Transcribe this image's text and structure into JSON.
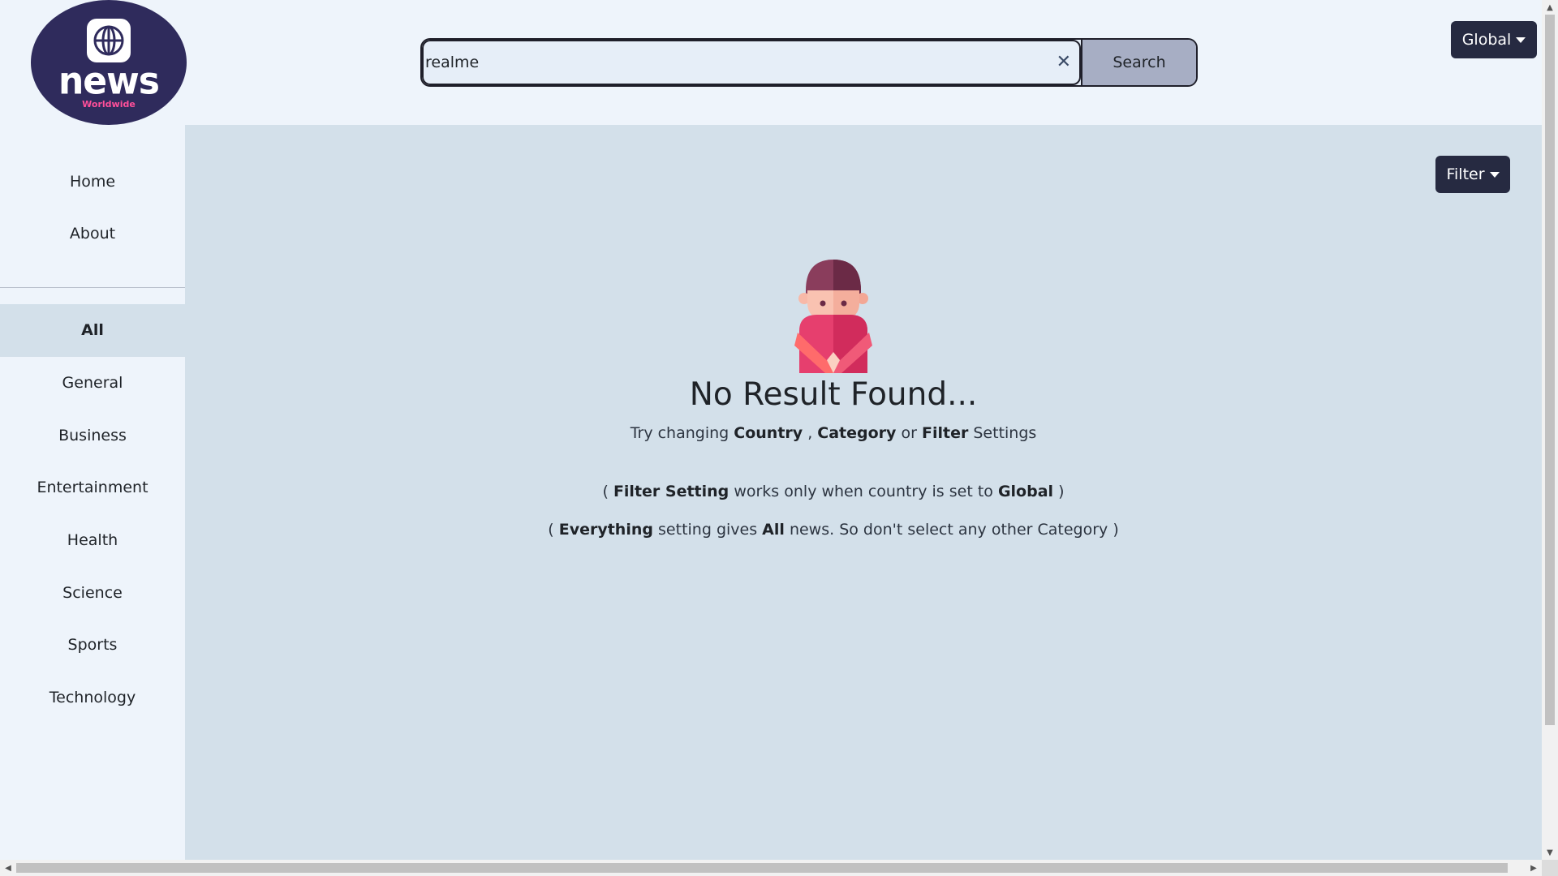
{
  "header": {
    "logo_word": "news",
    "logo_tag": "Worldwide",
    "search": {
      "value": "realme",
      "placeholder": "",
      "button_label": "Search"
    },
    "country_label": "Global"
  },
  "sidebar": {
    "nav": [
      {
        "label": "Home"
      },
      {
        "label": "About"
      }
    ],
    "categories": [
      {
        "label": "All",
        "active": true
      },
      {
        "label": "General"
      },
      {
        "label": "Business"
      },
      {
        "label": "Entertainment"
      },
      {
        "label": "Health"
      },
      {
        "label": "Science"
      },
      {
        "label": "Sports"
      },
      {
        "label": "Technology"
      }
    ]
  },
  "main": {
    "filter_label": "Filter",
    "empty": {
      "title": "No Result Found...",
      "sub": {
        "a": "Try changing",
        "country": "Country",
        "comma": ",",
        "category": "Category",
        "or": "or",
        "filter": "Filter",
        "settings": "Settings"
      },
      "note1": {
        "open": "(",
        "bold1": "Filter Setting",
        "mid": "works only when country is set to",
        "bold2": "Global",
        "close": ")"
      },
      "note2": {
        "open": "(",
        "bold1": "Everything",
        "mid1": "setting gives",
        "bold2": "All",
        "mid2": "news. So don't select any other Category",
        "close": ")"
      }
    }
  },
  "colors": {
    "accent_dark": "#262a41",
    "logo_bg": "#2f2b5c",
    "main_bg": "#d3e0ea",
    "sidebar_bg": "#eef4fb"
  },
  "icons": [
    "globe-icon",
    "clear-icon",
    "caret-down-icon",
    "person-illustration"
  ]
}
